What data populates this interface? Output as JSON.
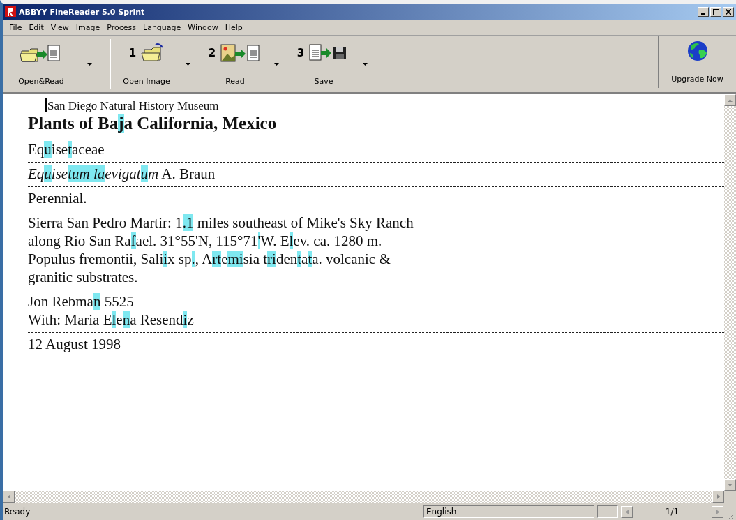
{
  "window": {
    "title": "ABBYY FineReader 5.0 Sprint"
  },
  "menu": [
    "File",
    "Edit",
    "View",
    "Image",
    "Process",
    "Language",
    "Window",
    "Help"
  ],
  "toolbar": {
    "buttons": [
      {
        "kind": "open-read",
        "label": "Open&Read"
      },
      {
        "kind": "open-image",
        "number": "1",
        "label": "Open Image"
      },
      {
        "kind": "read",
        "number": "2",
        "label": "Read"
      },
      {
        "kind": "save",
        "number": "3",
        "label": "Save"
      }
    ],
    "upgrade": {
      "label": "Upgrade Now"
    }
  },
  "document": {
    "blocks": [
      {
        "lines": [
          {
            "kind": "subtitle",
            "runs": [
              {
                "text": "San Diego Natural History Museum",
                "uncertain": false
              }
            ]
          },
          {
            "kind": "heading",
            "runs": [
              {
                "text": "Plants of Ba",
                "uncertain": false
              },
              {
                "text": "j",
                "uncertain": true
              },
              {
                "text": "a California, Mexico",
                "uncertain": false
              }
            ]
          }
        ]
      },
      {
        "lines": [
          {
            "kind": "body",
            "runs": [
              {
                "text": "Eq",
                "uncertain": false
              },
              {
                "text": "u",
                "uncertain": true
              },
              {
                "text": "ise",
                "uncertain": false
              },
              {
                "text": "t",
                "uncertain": true
              },
              {
                "text": "aceae",
                "uncertain": false
              }
            ]
          }
        ]
      },
      {
        "lines": [
          {
            "kind": "body",
            "runs": [
              {
                "text": "*Eq*",
                "uncertain": false
              },
              {
                "text": "*u*",
                "uncertain": true
              },
              {
                "text": "*ise*",
                "uncertain": false
              },
              {
                "text": "*tum*",
                "uncertain": true
              },
              {
                "text": " *la*",
                "uncertain": true
              },
              {
                "text": "*evigat*",
                "uncertain": false
              },
              {
                "text": "*u*",
                "uncertain": true
              },
              {
                "text": "*m* A. Braun",
                "uncertain": false
              }
            ]
          }
        ]
      },
      {
        "lines": [
          {
            "kind": "body",
            "runs": [
              {
                "text": "Perennial.",
                "uncertain": false
              }
            ]
          }
        ]
      },
      {
        "lines": [
          {
            "kind": "body",
            "runs": [
              {
                "text": "Sierra San Pedro Martir: 1",
                "uncertain": false
              },
              {
                "text": ".1",
                "uncertain": true
              },
              {
                "text": " miles southeast of Mike's Sky Ranch",
                "uncertain": false
              }
            ]
          },
          {
            "kind": "body",
            "runs": [
              {
                "text": "along Rio San Ra",
                "uncertain": false
              },
              {
                "text": "f",
                "uncertain": true
              },
              {
                "text": "ael. 31°55'N, 115°71",
                "uncertain": false
              },
              {
                "text": "'",
                "uncertain": true
              },
              {
                "text": "W. E",
                "uncertain": false
              },
              {
                "text": "l",
                "uncertain": true
              },
              {
                "text": "ev. ca. 1280 m.",
                "uncertain": false
              }
            ]
          },
          {
            "kind": "body",
            "runs": [
              {
                "text": "Populus fremontii, Sali",
                "uncertain": false
              },
              {
                "text": "i",
                "uncertain": true
              },
              {
                "text": "x sp",
                "uncertain": false
              },
              {
                "text": ".",
                "uncertain": true
              },
              {
                "text": ", A",
                "uncertain": false
              },
              {
                "text": "rt",
                "uncertain": true
              },
              {
                "text": "e",
                "uncertain": false
              },
              {
                "text": "mi",
                "uncertain": true
              },
              {
                "text": "sia t",
                "uncertain": false
              },
              {
                "text": "ri",
                "uncertain": true
              },
              {
                "text": "den",
                "uncertain": false
              },
              {
                "text": "t",
                "uncertain": true
              },
              {
                "text": "a",
                "uncertain": false
              },
              {
                "text": "t",
                "uncertain": true
              },
              {
                "text": "a. volcanic &",
                "uncertain": false
              }
            ]
          },
          {
            "kind": "body",
            "runs": [
              {
                "text": "granitic substrates.",
                "uncertain": false
              }
            ]
          }
        ]
      },
      {
        "lines": [
          {
            "kind": "body",
            "runs": [
              {
                "text": "Jon Rebma",
                "uncertain": false
              },
              {
                "text": "n",
                "uncertain": true
              },
              {
                "text": " 5525",
                "uncertain": false
              }
            ]
          },
          {
            "kind": "body",
            "runs": [
              {
                "text": "With: Maria E",
                "uncertain": false
              },
              {
                "text": "l",
                "uncertain": true
              },
              {
                "text": "e",
                "uncertain": false
              },
              {
                "text": "n",
                "uncertain": true
              },
              {
                "text": "a Resend",
                "uncertain": false
              },
              {
                "text": "i",
                "uncertain": true
              },
              {
                "text": "z",
                "uncertain": false
              }
            ]
          }
        ]
      },
      {
        "lines": [
          {
            "kind": "date",
            "runs": [
              {
                "text": "12 August 1998",
                "uncertain": false
              }
            ]
          }
        ]
      }
    ]
  },
  "status_bar": {
    "message": "Ready",
    "language": "English",
    "page": "1/1"
  }
}
